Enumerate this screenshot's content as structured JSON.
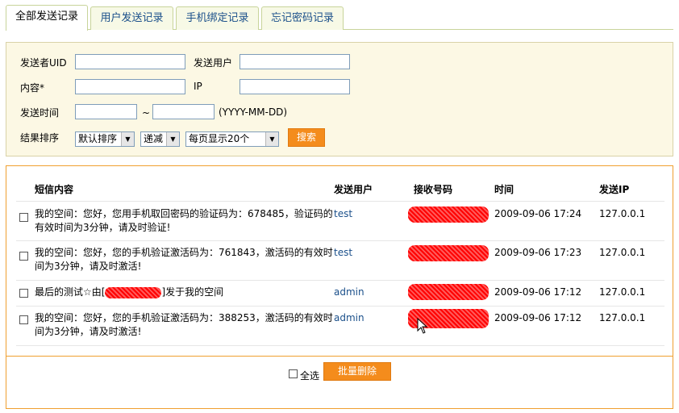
{
  "tabs": [
    {
      "label": "全部发送记录",
      "active": true
    },
    {
      "label": "用户发送记录",
      "active": false
    },
    {
      "label": "手机绑定记录",
      "active": false
    },
    {
      "label": "忘记密码记录",
      "active": false
    }
  ],
  "search": {
    "sender_uid_label": "发送者UID",
    "send_user_label": "发送用户",
    "content_label": "内容*",
    "ip_label": "IP",
    "send_time_label": "发送时间",
    "tilde": "~",
    "date_format": "(YYYY-MM-DD)",
    "sort_label": "结果排序",
    "sort_select": "默认排序",
    "order_select": "递减",
    "perpage_select": "每页显示20个",
    "search_button": "搜索"
  },
  "table": {
    "headers": {
      "content": "短信内容",
      "user": "发送用户",
      "recv": "接收号码",
      "time": "时间",
      "ip": "发送IP"
    },
    "rows": [
      {
        "content": "我的空间：您好，您用手机取回密码的验证码为：678485，验证码的有效时间为3分钟，请及时验证!",
        "user": "test",
        "time": "2009-09-06 17:24",
        "ip": "127.0.0.1"
      },
      {
        "content": "我的空间：您好，您的手机验证激活码为：761843，激活码的有效时间为3分钟，请及时激活!",
        "user": "test",
        "time": "2009-09-06 17:23",
        "ip": "127.0.0.1"
      },
      {
        "content_prefix": "最后的测试☆由[",
        "content_suffix": "]发于我的空间",
        "user": "admin",
        "time": "2009-09-06 17:12",
        "ip": "127.0.0.1"
      },
      {
        "content": "我的空间：您好，您的手机验证激活码为：388253，激活码的有效时间为3分钟，请及时激活!",
        "user": "admin",
        "time": "2009-09-06 17:12",
        "ip": "127.0.0.1"
      }
    ]
  },
  "footer": {
    "select_all_label": "全选",
    "batch_delete_button": "批量删除"
  }
}
